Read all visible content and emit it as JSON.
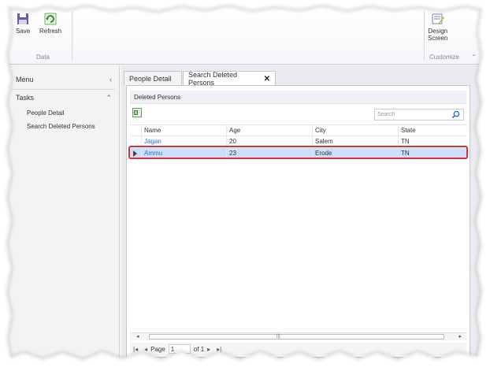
{
  "ribbon": {
    "save_label": "Save",
    "refresh_label": "Refresh",
    "data_group_label": "Data",
    "design_label_line1": "Design",
    "design_label_line2": "Screen",
    "customize_group_label": "Customize"
  },
  "nav": {
    "menu_label": "Menu",
    "tasks_label": "Tasks",
    "items": [
      {
        "label": "People Detail"
      },
      {
        "label": "Search Deleted Persons"
      }
    ]
  },
  "tabs": [
    {
      "label": "People Detail"
    },
    {
      "label": "Search Deleted Persons"
    }
  ],
  "panel": {
    "title": "Deleted Persons",
    "search_placeholder": "Search"
  },
  "grid": {
    "columns": [
      "Name",
      "Age",
      "City",
      "State"
    ],
    "rows": [
      [
        "Jagan",
        "20",
        "Salem",
        "TN"
      ],
      [
        "Ammu",
        "23",
        "Erode",
        "TN"
      ]
    ],
    "selected_row": 1
  },
  "pager": {
    "page_label": "Page",
    "page_value": "1",
    "of_label": "of 1"
  },
  "colors": {
    "selection_bg": "#cbe0f7",
    "selection_outline": "#d9303d",
    "link": "#2a6fcf"
  }
}
